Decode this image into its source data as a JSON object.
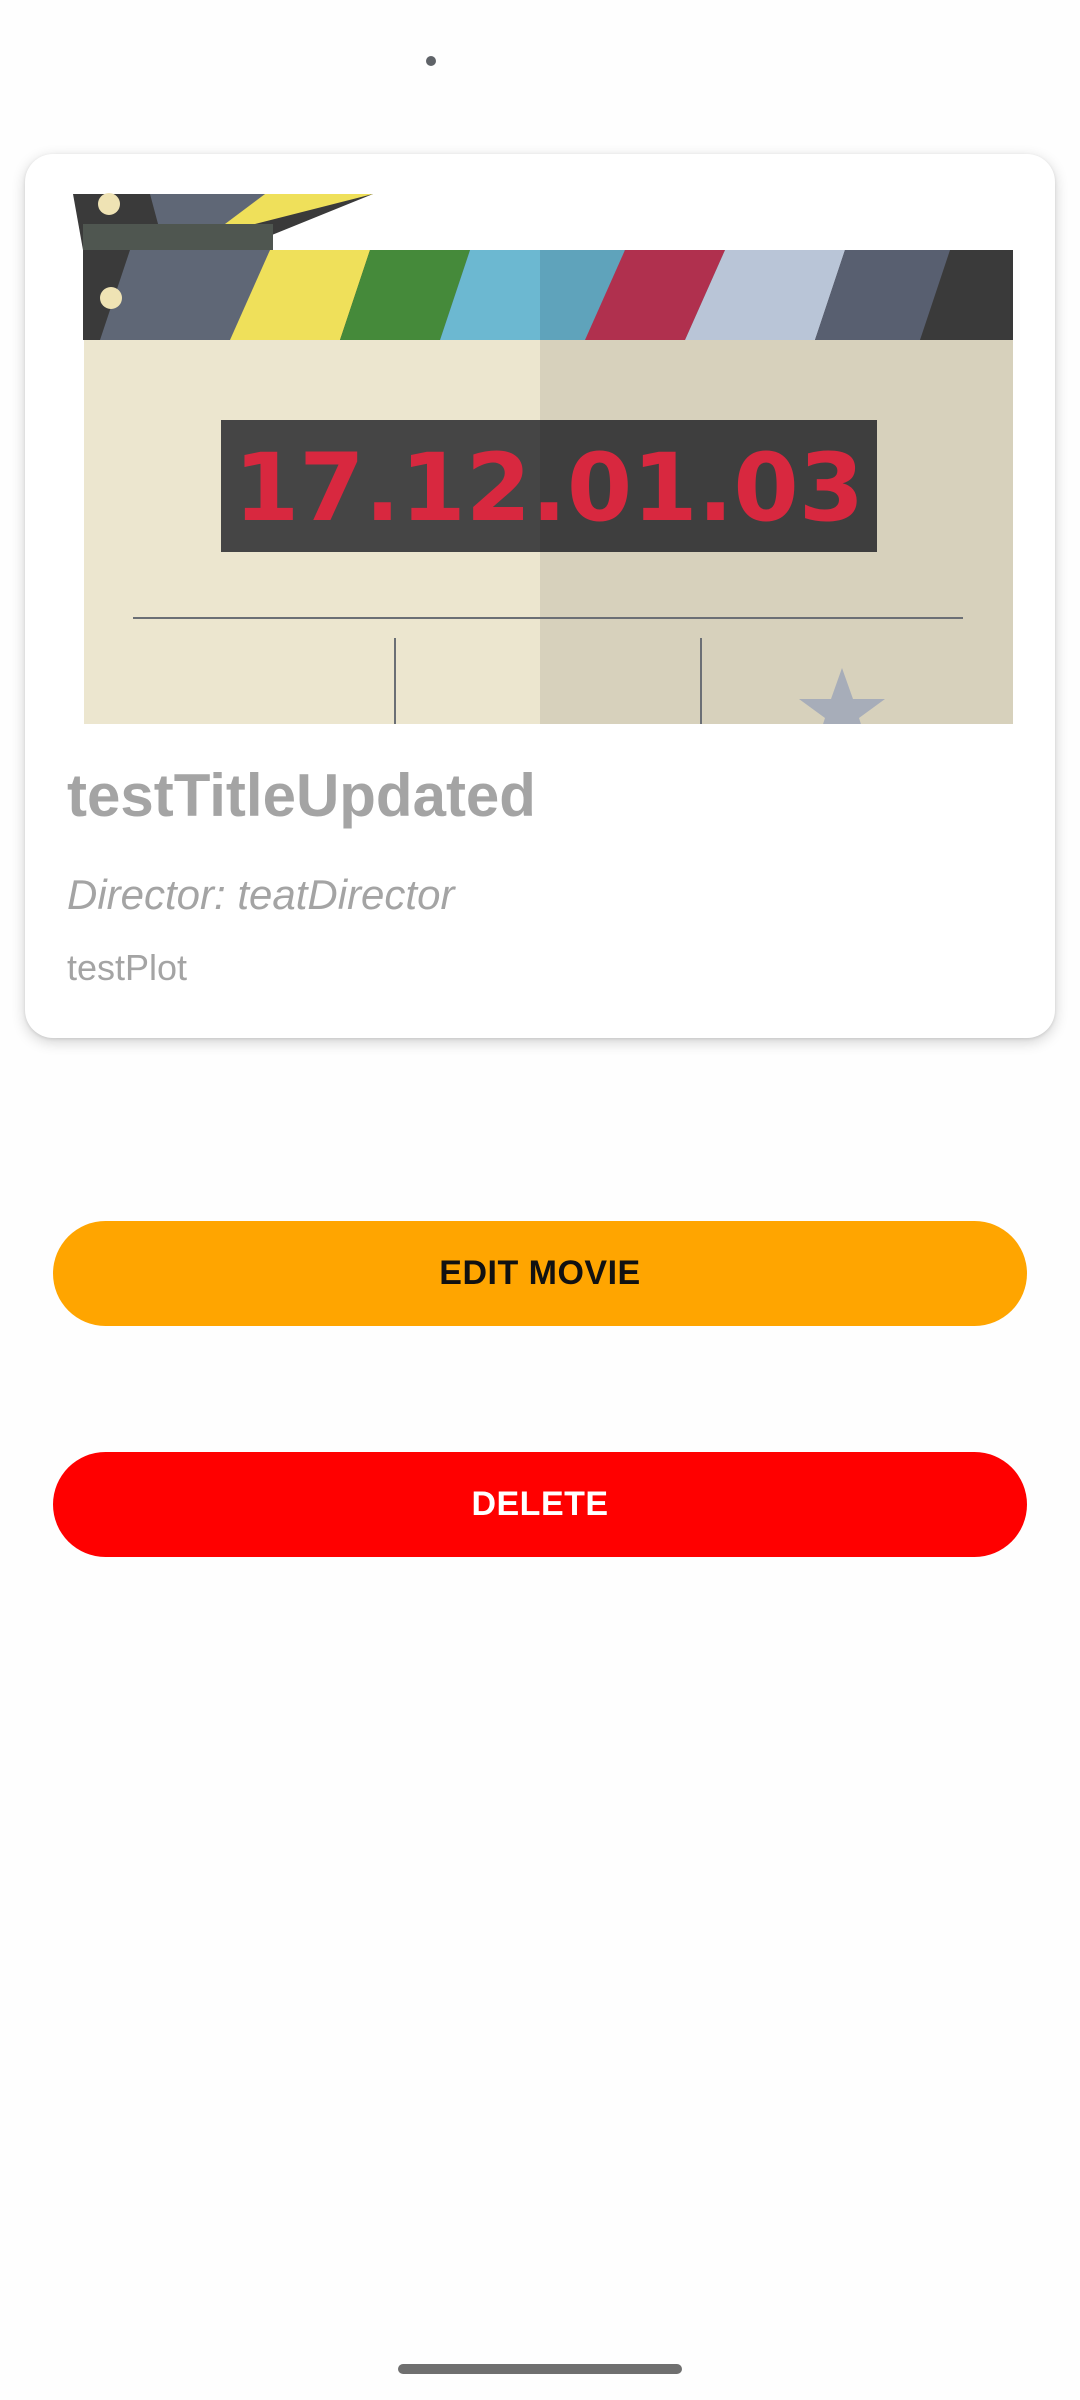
{
  "status_bar": {
    "icon": "camera-dot"
  },
  "movie": {
    "poster": {
      "clapper_display": "17.12.01.03",
      "icon": "clapperboard-image"
    },
    "title": "testTitleUpdated",
    "director": "Director: teatDirector",
    "plot": "testPlot"
  },
  "actions": {
    "edit_label": "EDIT MOVIE",
    "delete_label": "DELETE"
  },
  "colors": {
    "edit_button": "#ffa500",
    "delete_button": "#ff0000",
    "text_muted": "#a4a4a4",
    "clapper_digits": "#d8283f"
  },
  "nav": {
    "gesture_bar": "home-indicator"
  }
}
